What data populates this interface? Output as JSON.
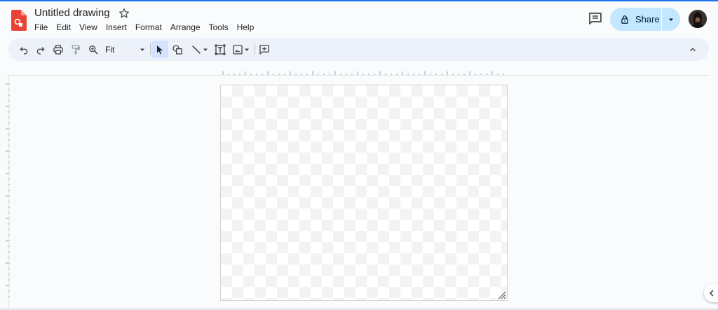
{
  "document": {
    "title": "Untitled drawing"
  },
  "menu": [
    "File",
    "Edit",
    "View",
    "Insert",
    "Format",
    "Arrange",
    "Tools",
    "Help"
  ],
  "share": {
    "label": "Share"
  },
  "toolbar": {
    "zoom_value": "Fit",
    "icons": [
      "undo-icon",
      "redo-icon",
      "print-icon",
      "paint-format-icon",
      "zoom-icon",
      "select-icon",
      "shape-icon",
      "line-icon",
      "textbox-icon",
      "image-icon",
      "comment-add-icon",
      "collapse-icon"
    ]
  },
  "colors": {
    "accent": "#1a73e8",
    "share_bg": "#c2e7ff",
    "toolbar_bg": "#edf2fa",
    "logo_red": "#ea4335",
    "active_tool": "#d3e3fd"
  }
}
